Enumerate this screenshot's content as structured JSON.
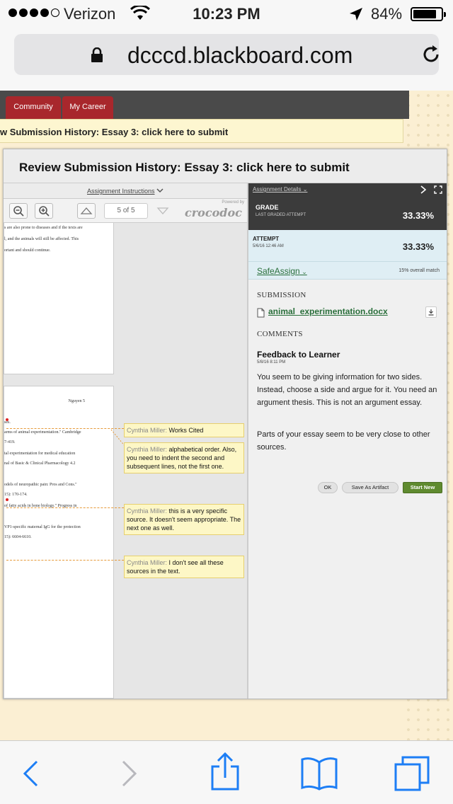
{
  "status_bar": {
    "carrier": "Verizon",
    "time": "10:23 PM",
    "battery_percent": "84%",
    "battery_level": 0.84,
    "signal_bars_filled": 4,
    "signal_bars_total": 5
  },
  "browser": {
    "url": "dcccd.blackboard.com"
  },
  "background_page": {
    "nav_tabs": [
      "Community",
      "My Career"
    ],
    "breadcrumb": "w Submission History: Essay 3: click here to submit"
  },
  "modal": {
    "title": "Review Submission History: Essay 3: click here to submit"
  },
  "viewer": {
    "assignment_instructions": "Assignment Instructions",
    "page_counter": "5 of 5",
    "powered_by": "Powered by",
    "brand": "crocodoc",
    "page4_lines": [
      "s are also prone to diseases and if the texts are",
      "l, and the animals will still be affected. This",
      "ortant and should continue."
    ],
    "page5_header": "Nguyen 5",
    "page5_lines": [
      "ses.",
      "arms of animal experimentation.\" Cambridge",
      "7-419.",
      "tal experimentation for medical education",
      "nal of Basic & Clinical Pharmacology 4.2",
      "odels of neuropathic pain: Pros and Cons.\"",
      "15): 170-174.",
      "of fatty acids in bone biology.\" Progress in",
      "VP1-specific maternal IgG for the protection",
      "15): 6604-6610."
    ],
    "annotations": [
      {
        "author": "Cynthia Miller:",
        "text": "Works Cited"
      },
      {
        "author": "Cynthia Miller:",
        "text": "alphabetical order. Also, you need to indent the second and subsequent lines, not the first one."
      },
      {
        "author": "Cynthia Miller:",
        "text": "this is a very specific source. It doesn't seem appropriate. The next one as well."
      },
      {
        "author": "Cynthia Miller:",
        "text": "I don't see all these sources in the text."
      }
    ]
  },
  "details": {
    "assignment_details": "Assignment Details",
    "grade_label": "GRADE",
    "grade_sub": "LAST GRADED ATTEMPT",
    "grade_value": "33.33%",
    "attempt_label": "ATTEMPT",
    "attempt_date": "5/6/16 12:46 AM",
    "attempt_value": "33.33%",
    "safeassign": "SafeAssign",
    "match": "15% overall match",
    "submission_heading": "SUBMISSION",
    "file_name": "animal_experimentation.docx",
    "comments_heading": "COMMENTS",
    "feedback_title": "Feedback to Learner",
    "feedback_date": "5/8/16 8:11 PM",
    "feedback_p1": "You seem to be giving information for two sides. Instead, choose a side and argue for it. You need an argument thesis. This is not an argument essay.",
    "feedback_p2": "Parts of your essay seem to be very close to other sources.",
    "buttons": {
      "ok": "OK",
      "save_artifact": "Save As Artifact",
      "start_new": "Start New"
    }
  },
  "colors": {
    "nav_tab": "#a8272c",
    "grade_bg": "#3b3b3b",
    "attempt_bg": "#dfeef4",
    "link_green": "#2a6f3b",
    "ios_blue": "#1d7ef5",
    "annotation_bg": "#fdf7c6"
  },
  "icons": [
    "wifi-icon",
    "location-arrow-icon",
    "lock-icon",
    "reload-icon",
    "zoom-out-icon",
    "zoom-in-icon",
    "page-up-icon",
    "page-down-icon",
    "chevron-right-icon",
    "expand-icon",
    "file-icon",
    "download-icon",
    "back-icon",
    "forward-icon",
    "share-icon",
    "bookmarks-icon",
    "tabs-icon"
  ]
}
